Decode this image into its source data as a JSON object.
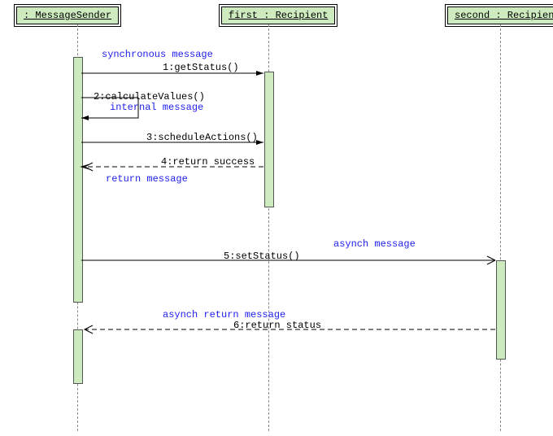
{
  "participants": {
    "sender": {
      "name": ": MessageSender"
    },
    "first": {
      "name": "first : Recipient"
    },
    "second": {
      "name": "second : Recipient"
    }
  },
  "messages": {
    "m1": "1:getStatus()",
    "m2": "2:calculateValues()",
    "m3": "3:scheduleActions()",
    "m4": "4:return success",
    "m5": "5:setStatus()",
    "m6": "6:return status"
  },
  "annotations": {
    "sync": "synchronous message",
    "internal": "internal message",
    "ret": "return message",
    "asynch": "asynch message",
    "asynch_ret": "asynch return message"
  },
  "chart_data": {
    "type": "sequence-diagram",
    "participants": [
      {
        "id": "sender",
        "name": "MessageSender",
        "role": ""
      },
      {
        "id": "first",
        "name": "Recipient",
        "role": "first"
      },
      {
        "id": "second",
        "name": "Recipient",
        "role": "second"
      }
    ],
    "messages": [
      {
        "n": 1,
        "from": "sender",
        "to": "first",
        "label": "getStatus()",
        "kind": "sync"
      },
      {
        "n": 2,
        "from": "sender",
        "to": "sender",
        "label": "calculateValues()",
        "kind": "self"
      },
      {
        "n": 3,
        "from": "sender",
        "to": "first",
        "label": "scheduleActions()",
        "kind": "sync"
      },
      {
        "n": 4,
        "from": "first",
        "to": "sender",
        "label": "return success",
        "kind": "return"
      },
      {
        "n": 5,
        "from": "sender",
        "to": "second",
        "label": "setStatus()",
        "kind": "async"
      },
      {
        "n": 6,
        "from": "second",
        "to": "sender",
        "label": "return status",
        "kind": "async-return"
      }
    ]
  }
}
